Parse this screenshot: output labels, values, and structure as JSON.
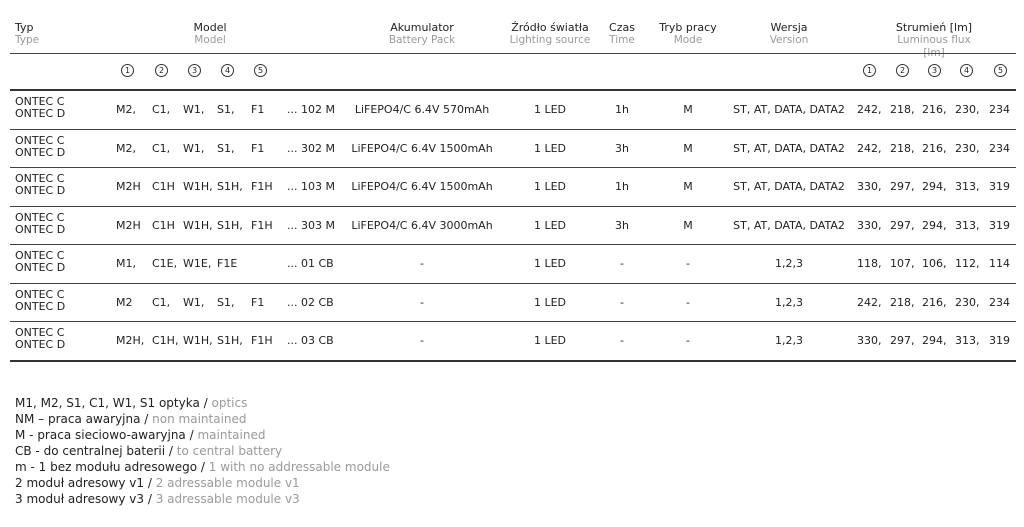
{
  "headers": {
    "typ": {
      "pl": "Typ",
      "en": "Type"
    },
    "model": {
      "pl": "Model",
      "en": "Model"
    },
    "akumulator": {
      "pl": "Akumulator",
      "en": "Battery Pack"
    },
    "zrodlo": {
      "pl": "Źródło światła",
      "en": "Lighting source"
    },
    "czas": {
      "pl": "Czas",
      "en": "Time"
    },
    "tryb": {
      "pl": "Tryb pracy",
      "en": "Mode"
    },
    "wersja": {
      "pl": "Wersja",
      "en": "Version"
    },
    "strumien": {
      "pl": "Strumień [lm]",
      "en": "Luminous flux [lm]"
    }
  },
  "circled": [
    "1",
    "2",
    "3",
    "4",
    "5"
  ],
  "rows": [
    {
      "typ": [
        "ONTEC C",
        "ONTEC D"
      ],
      "m": [
        "M2,",
        "C1,",
        "W1,",
        "S1,",
        "F1"
      ],
      "code": "... 102 M",
      "akum": "LiFEPO4/C 6.4V 570mAh",
      "zrodlo": "1 LED",
      "czas": "1h",
      "tryb": "M",
      "wersja": "ST, AT, DATA, DATA2",
      "flux": [
        "242,",
        "218,",
        "216,",
        "230,",
        "234"
      ]
    },
    {
      "typ": [
        "ONTEC C",
        "ONTEC D"
      ],
      "m": [
        "M2,",
        "C1,",
        "W1,",
        "S1,",
        "F1"
      ],
      "code": "... 302 M",
      "akum": "LiFEPO4/C 6.4V 1500mAh",
      "zrodlo": "1 LED",
      "czas": "3h",
      "tryb": "M",
      "wersja": "ST, AT, DATA, DATA2",
      "flux": [
        "242,",
        "218,",
        "216,",
        "230,",
        "234"
      ]
    },
    {
      "typ": [
        "ONTEC C",
        "ONTEC D"
      ],
      "m": [
        "M2H",
        "C1H",
        "W1H,",
        "S1H,",
        "F1H"
      ],
      "code": "... 103 M",
      "akum": "LiFEPO4/C 6.4V 1500mAh",
      "zrodlo": "1 LED",
      "czas": "1h",
      "tryb": "M",
      "wersja": "ST, AT, DATA, DATA2",
      "flux": [
        "330,",
        "297,",
        "294,",
        "313,",
        "319"
      ]
    },
    {
      "typ": [
        "ONTEC C",
        "ONTEC D"
      ],
      "m": [
        "M2H",
        "C1H",
        "W1H,",
        "S1H,",
        "F1H"
      ],
      "code": "... 303 M",
      "akum": "LiFEPO4/C 6.4V 3000mAh",
      "zrodlo": "1 LED",
      "czas": "3h",
      "tryb": "M",
      "wersja": "ST, AT, DATA, DATA2",
      "flux": [
        "330,",
        "297,",
        "294,",
        "313,",
        "319"
      ]
    },
    {
      "typ": [
        "ONTEC C",
        "ONTEC D"
      ],
      "m": [
        "M1,",
        "C1E,",
        "W1E,",
        "F1E",
        ""
      ],
      "code": "... 01 CB",
      "akum": "-",
      "zrodlo": "1 LED",
      "czas": "-",
      "tryb": "-",
      "wersja": "1,2,3",
      "flux": [
        "118,",
        "107,",
        "106,",
        "112,",
        "114"
      ]
    },
    {
      "typ": [
        "ONTEC C",
        "ONTEC D"
      ],
      "m": [
        "M2",
        "C1,",
        "W1,",
        "S1,",
        "F1"
      ],
      "code": "... 02 CB",
      "akum": "-",
      "zrodlo": "1 LED",
      "czas": "-",
      "tryb": "-",
      "wersja": "1,2,3",
      "flux": [
        "242,",
        "218,",
        "216,",
        "230,",
        "234"
      ]
    },
    {
      "typ": [
        "ONTEC C",
        "ONTEC D"
      ],
      "m": [
        "M2H,",
        "C1H,",
        "W1H,",
        "S1H,",
        "F1H"
      ],
      "code": "... 03 CB",
      "akum": "-",
      "zrodlo": "1 LED",
      "czas": "-",
      "tryb": "-",
      "wersja": "1,2,3",
      "flux": [
        "330,",
        "297,",
        "294,",
        "313,",
        "319"
      ]
    }
  ],
  "legend": [
    {
      "pl": "M1, M2, S1, C1, W1, S1 optyka / ",
      "en": "optics"
    },
    {
      "pl": "NM – praca awaryjna / ",
      "en": "non maintained"
    },
    {
      "pl": "M - praca sieciowo-awaryjna / ",
      "en": "maintained"
    },
    {
      "pl": "CB - do centralnej baterii / ",
      "en": "to central battery"
    },
    {
      "pl": "m - 1 bez modułu adresowego / ",
      "en": "1 with no addressable module"
    },
    {
      "pl": "2 moduł adresowy v1 / ",
      "en": "2 adressable module v1"
    },
    {
      "pl": "3 moduł adresowy v3 / ",
      "en": "3 adressable module v3"
    }
  ]
}
